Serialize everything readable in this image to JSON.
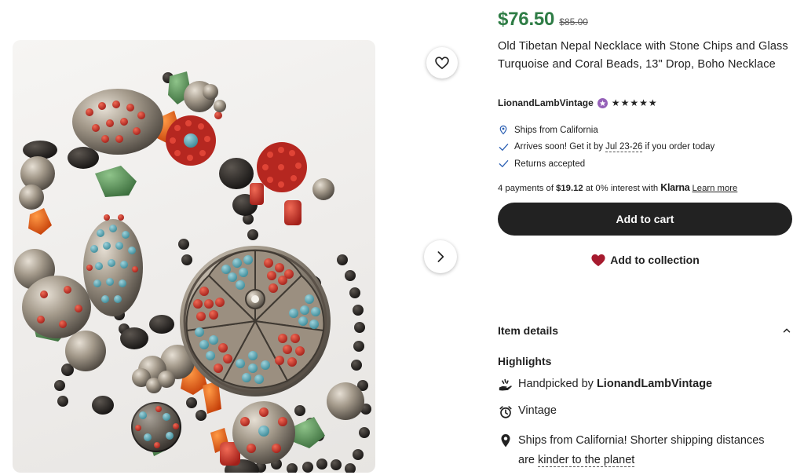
{
  "product": {
    "price": "$76.50",
    "original_price": "$85.00",
    "title": "Old Tibetan Nepal Necklace with Stone Chips and Glass Turquoise and Coral Beads, 13\" Drop, Boho Necklace",
    "image_alt": "Old Tibetan necklace with coral and turquoise beads"
  },
  "seller": {
    "name": "LionandLambVintage",
    "rating_stars": 5,
    "badge_icon": "star-seller-icon"
  },
  "shipping": {
    "ships_from": "Ships from California",
    "arrives_prefix": "Arrives soon! Get it by",
    "arrives_dates": "Jul 23-26",
    "arrives_suffix": "if you order today",
    "returns": "Returns accepted"
  },
  "payment": {
    "installments_prefix": "4 payments of",
    "installment_amount": "$19.12",
    "installments_middle": "at 0% interest with",
    "provider": "Klarna",
    "learn_more": "Learn more"
  },
  "actions": {
    "add_to_cart": "Add to cart",
    "add_to_collection": "Add to collection"
  },
  "details": {
    "section_title": "Item details",
    "highlights_title": "Highlights",
    "handpicked_prefix": "Handpicked by",
    "handpicked_shop": "LionandLambVintage",
    "vintage": "Vintage",
    "ships_line1": "Ships from California! Shorter shipping distances",
    "ships_line2_prefix": "are",
    "ships_line2_link": "kinder to the planet"
  },
  "colors": {
    "price_green": "#2f7d46",
    "button_dark": "#222222",
    "heart_red": "#a61a2e",
    "star_seller_purple": "#9560b8",
    "pin_blue": "#2b5fb3"
  },
  "icons": {
    "favorite": "heart-outline-icon",
    "next": "chevron-right-icon",
    "location": "location-pin-icon",
    "check": "checkmark-icon",
    "collection": "heart-filled-icon",
    "collapse": "chevron-up-icon",
    "handpicked": "hand-icon",
    "vintage": "alarm-clock-icon",
    "ships": "map-pin-icon"
  }
}
